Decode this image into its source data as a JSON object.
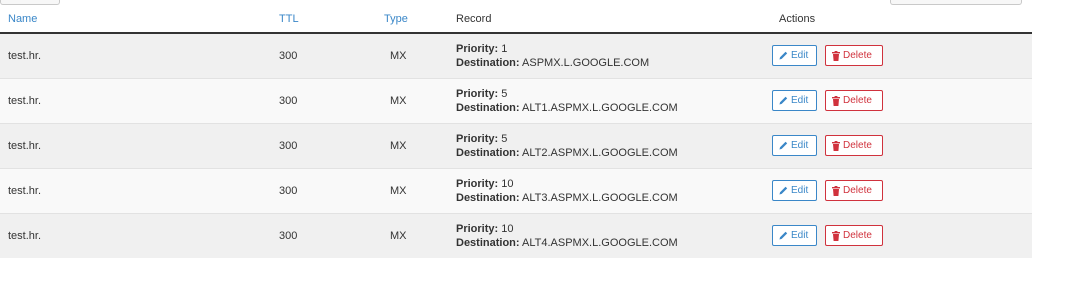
{
  "columns": {
    "name": "Name",
    "ttl": "TTL",
    "type": "Type",
    "record": "Record",
    "actions": "Actions"
  },
  "labels": {
    "priority": "Priority:",
    "destination": "Destination:",
    "edit": "Edit",
    "delete": "Delete"
  },
  "icons": {
    "edit": "pencil-icon",
    "delete": "trash-icon"
  },
  "colors": {
    "link": "#3a87c8",
    "danger": "#d0323d"
  },
  "rows": [
    {
      "name": "test.hr.",
      "ttl": "300",
      "type": "MX",
      "priority": "1",
      "destination": "ASPMX.L.GOOGLE.COM"
    },
    {
      "name": "test.hr.",
      "ttl": "300",
      "type": "MX",
      "priority": "5",
      "destination": "ALT1.ASPMX.L.GOOGLE.COM"
    },
    {
      "name": "test.hr.",
      "ttl": "300",
      "type": "MX",
      "priority": "5",
      "destination": "ALT2.ASPMX.L.GOOGLE.COM"
    },
    {
      "name": "test.hr.",
      "ttl": "300",
      "type": "MX",
      "priority": "10",
      "destination": "ALT3.ASPMX.L.GOOGLE.COM"
    },
    {
      "name": "test.hr.",
      "ttl": "300",
      "type": "MX",
      "priority": "10",
      "destination": "ALT4.ASPMX.L.GOOGLE.COM"
    }
  ]
}
